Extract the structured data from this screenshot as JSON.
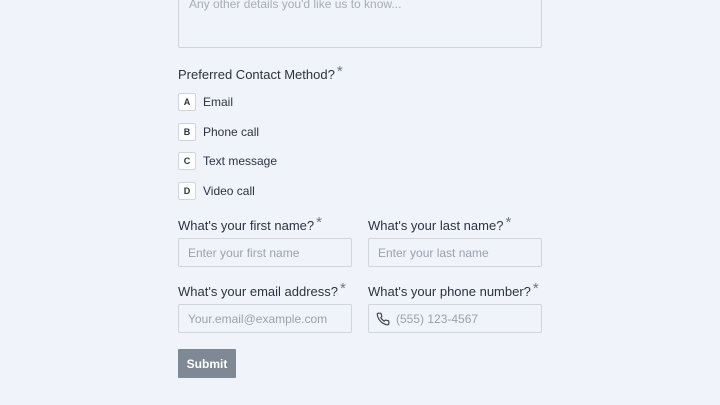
{
  "details": {
    "placeholder": "Any other details you'd like us to know..."
  },
  "contact_method": {
    "label": "Preferred Contact Method?",
    "required_mark": "*",
    "options": [
      {
        "key": "A",
        "label": "Email"
      },
      {
        "key": "B",
        "label": "Phone call"
      },
      {
        "key": "C",
        "label": "Text message"
      },
      {
        "key": "D",
        "label": "Video call"
      }
    ]
  },
  "first_name": {
    "label": "What's your first name?",
    "required_mark": "*",
    "placeholder": "Enter your first name"
  },
  "last_name": {
    "label": "What's your last name?",
    "required_mark": "*",
    "placeholder": "Enter your last name"
  },
  "email": {
    "label": "What's your email address?",
    "required_mark": "*",
    "placeholder": "Your.email@example.com"
  },
  "phone": {
    "label": "What's your phone number?",
    "required_mark": "*",
    "placeholder": "(555) 123-4567",
    "icon": "phone-icon"
  },
  "submit": {
    "label": "Submit"
  },
  "colors": {
    "background": "#f0f3f9",
    "border": "#cfd5de",
    "text": "#2b3440",
    "placeholder": "#9aa2ae",
    "button": "#7f8996"
  }
}
